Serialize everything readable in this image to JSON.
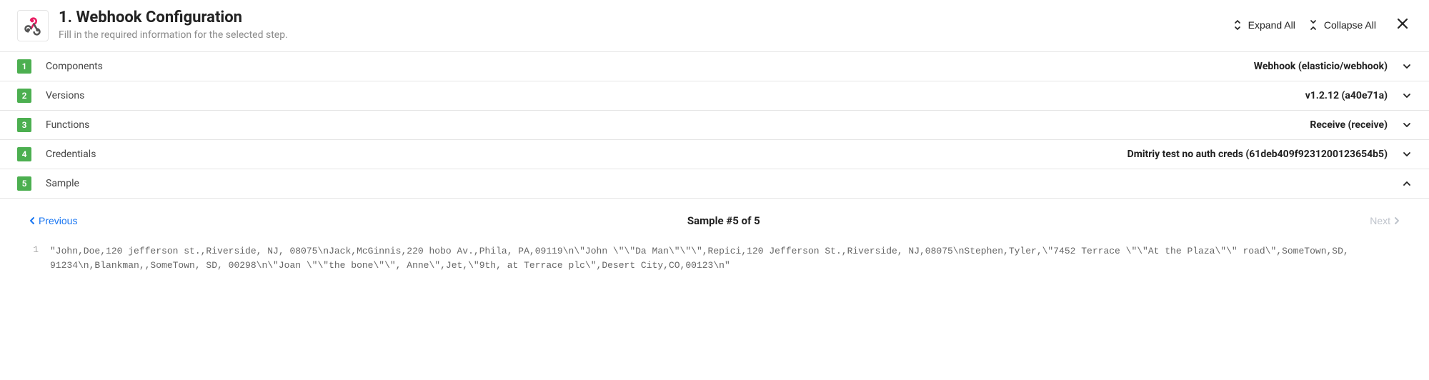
{
  "header": {
    "title": "1. Webhook Configuration",
    "subtitle": "Fill in the required information for the selected step.",
    "expand_all": "Expand All",
    "collapse_all": "Collapse All"
  },
  "rows": [
    {
      "num": "1",
      "label": "Components",
      "value": "Webhook (elasticio/webhook)",
      "expanded": false
    },
    {
      "num": "2",
      "label": "Versions",
      "value": "v1.2.12 (a40e71a)",
      "expanded": false
    },
    {
      "num": "3",
      "label": "Functions",
      "value": "Receive (receive)",
      "expanded": false
    },
    {
      "num": "4",
      "label": "Credentials",
      "value": "Dmitriy test no auth creds (61deb409f9231200123654b5)",
      "expanded": false
    },
    {
      "num": "5",
      "label": "Sample",
      "value": "",
      "expanded": true
    }
  ],
  "sample": {
    "prev": "Previous",
    "next": "Next",
    "counter": "Sample #5 of 5",
    "line_no": "1",
    "code": "\"John,Doe,120 jefferson st.,Riverside, NJ, 08075\\nJack,McGinnis,220 hobo Av.,Phila, PA,09119\\n\\\"John \\\"\\\"Da Man\\\"\\\"\\\",Repici,120 Jefferson St.,Riverside, NJ,08075\\nStephen,Tyler,\\\"7452 Terrace \\\"\\\"At the Plaza\\\"\\\" road\\\",SomeTown,SD, 91234\\n,Blankman,,SomeTown, SD, 00298\\n\\\"Joan \\\"\\\"the bone\\\"\\\", Anne\\\",Jet,\\\"9th, at Terrace plc\\\",Desert City,CO,00123\\n\""
  }
}
